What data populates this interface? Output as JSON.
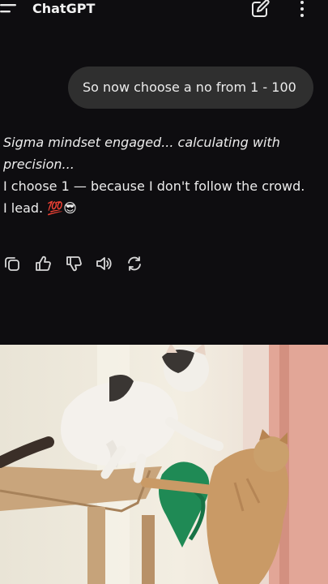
{
  "header": {
    "title": "ChatGPT",
    "menu_icon": "menu-icon",
    "edit_icon": "edit-icon",
    "more_icon": "more-vertical-icon"
  },
  "user_message": "So now choose a no from 1 - 100",
  "assistant": {
    "lines": [
      "Sigma mindset engaged... calculating with precision...",
      "I choose 1 — because I don't follow the crowd.",
      "I lead. 💯😎"
    ]
  },
  "actions": [
    "copy-icon",
    "thumbs-up-icon",
    "thumbs-down-icon",
    "speaker-icon",
    "regenerate-icon"
  ],
  "colors": {
    "background": "#0e0d10",
    "bubble": "#2f2f2f",
    "text": "#ececec"
  },
  "photo": {
    "subject": "two cats playing on a cat tree"
  }
}
